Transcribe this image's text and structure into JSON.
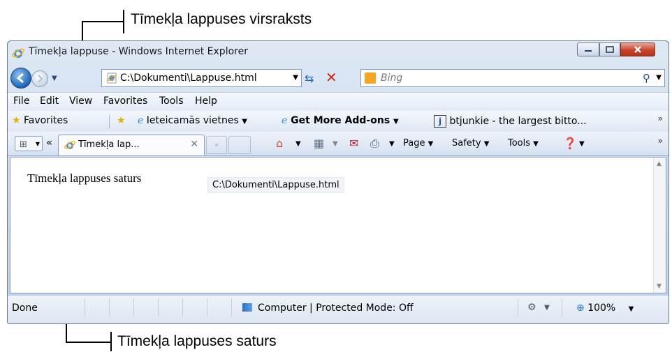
{
  "annotations": {
    "top_caption": "Tīmekļa lappuses virsraksts",
    "bottom_caption": "Tīmekļa lappuses saturs"
  },
  "window": {
    "title": "Tīmekļa lappuse - Windows Internet Explorer"
  },
  "nav": {
    "address": "C:\\Dokumenti\\Lappuse.html",
    "search_placeholder": "Bing"
  },
  "menu": {
    "items": [
      "File",
      "Edit",
      "View",
      "Favorites",
      "Tools",
      "Help"
    ]
  },
  "favorites_bar": {
    "favorites_label": "Favorites",
    "suggested_sites": "Ieteicamās vietnes",
    "addons": "Get More Add-ons",
    "btjunkie": "btjunkie - the largest bitto..."
  },
  "tabs": {
    "active_tab": "Tīmekļa lap..."
  },
  "commands": {
    "page": "Page",
    "safety": "Safety",
    "tools": "Tools"
  },
  "content": {
    "text": "Tīmekļa lappuses saturs",
    "tooltip": "C:\\Dokumenti\\Lappuse.html"
  },
  "status": {
    "done": "Done",
    "zone": "Computer | Protected Mode: Off",
    "zoom": "100%"
  },
  "icons": {
    "ie": "ie-logo-icon",
    "star": "favorites-star-icon",
    "home": "home-icon",
    "feeds": "feeds-icon",
    "mail": "mail-icon",
    "print": "print-icon",
    "help": "help-icon"
  }
}
